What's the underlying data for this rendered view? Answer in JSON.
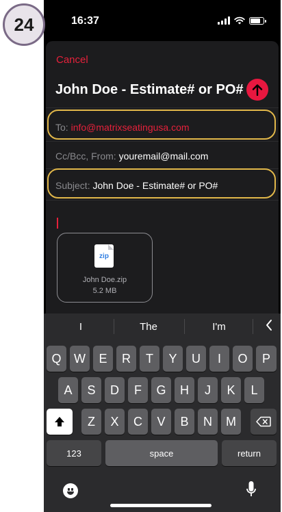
{
  "step": "24",
  "status": {
    "time": "16:37"
  },
  "compose": {
    "cancel": "Cancel",
    "title": "John Doe - Estimate# or PO#",
    "to_label": "To:",
    "to_value": "info@matrixseatingusa.com",
    "cc_label": "Cc/Bcc, From:",
    "cc_value": "youremail@mail.com",
    "subject_label": "Subject:",
    "subject_value": "John Doe - Estimate# or PO#",
    "attachment": {
      "icon_text": "zip",
      "name": "John Doe.zip",
      "size": "5.2 MB"
    }
  },
  "keyboard": {
    "suggestions": [
      "I",
      "The",
      "I'm"
    ],
    "rows": [
      [
        "Q",
        "W",
        "E",
        "R",
        "T",
        "Y",
        "U",
        "I",
        "O",
        "P"
      ],
      [
        "A",
        "S",
        "D",
        "F",
        "G",
        "H",
        "J",
        "K",
        "L"
      ],
      [
        "Z",
        "X",
        "C",
        "V",
        "B",
        "N",
        "M"
      ]
    ],
    "numbers_key": "123",
    "space_key": "space",
    "return_key": "return"
  },
  "colors": {
    "accent": "#e5213b",
    "highlight": "#e2b84a",
    "badge_border": "#7a6a86"
  }
}
